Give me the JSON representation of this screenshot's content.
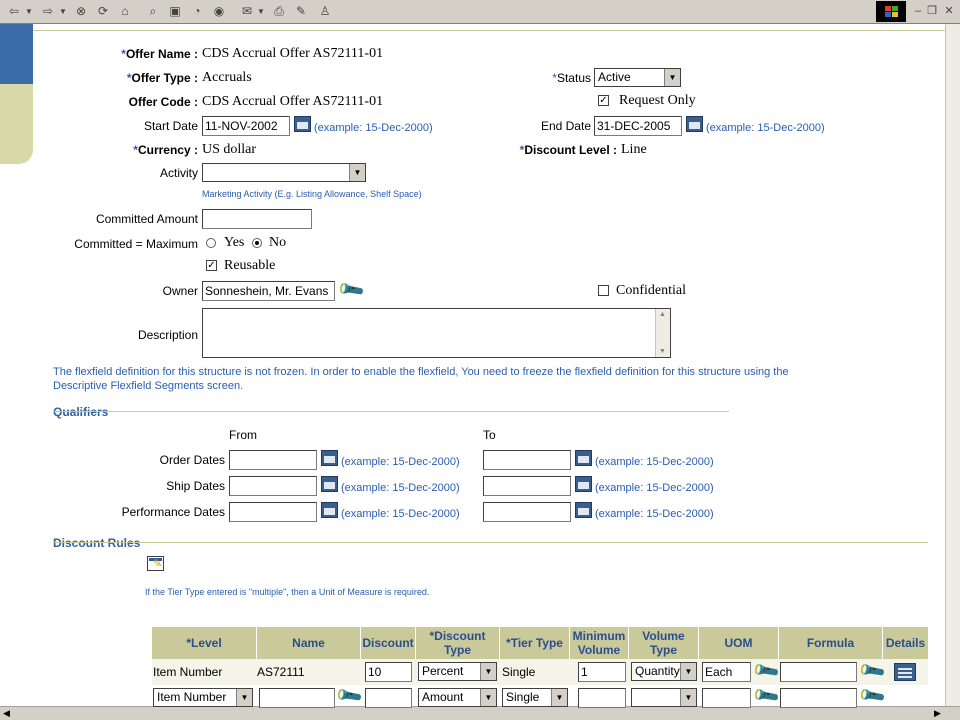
{
  "toolbar": {
    "icons": [
      "back-icon",
      "forward-icon",
      "stop-icon",
      "refresh-icon",
      "home-icon",
      "search-icon",
      "favorites-icon",
      "history-icon",
      "media-icon",
      "mail-icon",
      "print-icon",
      "edit-icon",
      "messenger-icon"
    ]
  },
  "offer": {
    "name_label": "*Offer Name :",
    "name": "CDS Accrual Offer AS72111-01",
    "type_label": "*Offer Type :",
    "type": "Accruals",
    "code_label": "Offer Code :",
    "code": "CDS Accrual Offer AS72111-01",
    "status_label": "*Status",
    "status": "Active",
    "request_only_label": "Request Only",
    "start_date_label": "Start Date",
    "start_date": "11-NOV-2002",
    "end_date_label": "End Date",
    "end_date": "31-DEC-2005",
    "date_example": "(example: 15-Dec-2000)",
    "currency_label": "*Currency :",
    "currency": "US dollar",
    "discount_level_label": "*Discount Level :",
    "discount_level": "Line",
    "activity_label": "Activity",
    "activity": "",
    "activity_hint": "Marketing Activity (E.g. Listing Allowance, Shelf Space)",
    "committed_amount_label": "Committed Amount",
    "committed_amount": "",
    "committed_max_label": "Committed = Maximum",
    "yes_label": "Yes",
    "no_label": "No",
    "reusable_label": "Reusable",
    "owner_label": "Owner",
    "owner": "Sonneshein, Mr. Evans",
    "confidential_label": "Confidential",
    "description_label": "Description",
    "description": "",
    "flexfield_note": "The flexfield definition for this structure is not frozen. In order to enable the flexfield, You need to freeze the flexfield definition for this structure using the Descriptive Flexfield Segments screen."
  },
  "qualifiers": {
    "title": "Qualifiers",
    "from_label": "From",
    "to_label": "To",
    "rows": [
      {
        "label": "Order Dates"
      },
      {
        "label": "Ship Dates"
      },
      {
        "label": "Performance Dates"
      }
    ],
    "example": "(example: 15-Dec-2000)"
  },
  "discount_rules": {
    "title": "Discount Rules",
    "tier_note": "If the Tier Type entered is \"multiple\", then a Unit of Measure is required.",
    "columns": [
      "*Level",
      "Name",
      "Discount",
      "*Discount Type",
      "*Tier Type",
      "Minimum Volume",
      "Volume Type",
      "UOM",
      "Formula",
      "Details"
    ],
    "row1": {
      "level": "Item Number",
      "name": "AS72111",
      "discount": "10",
      "discount_type": "Percent",
      "tier_type": "Single",
      "min_volume": "1",
      "volume_type": "Quantity",
      "uom": "Each",
      "formula": ""
    },
    "row2": {
      "level": "Item Number",
      "name": "",
      "discount": "",
      "discount_type": "Amount",
      "tier_type": "Single",
      "min_volume": "",
      "volume_type": "",
      "uom": "",
      "formula": ""
    }
  },
  "colors": {
    "accent": "#2a5db0",
    "table_header": "#c9c99a",
    "sidebar_blue": "#3c6ca8",
    "sidebar_khaki": "#d8d8a8"
  }
}
